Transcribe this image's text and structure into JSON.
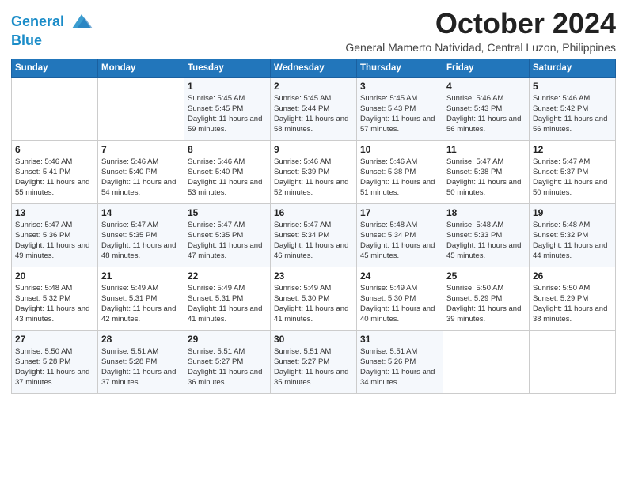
{
  "header": {
    "logo_line1": "General",
    "logo_line2": "Blue",
    "month_year": "October 2024",
    "location": "General Mamerto Natividad, Central Luzon, Philippines"
  },
  "days_of_week": [
    "Sunday",
    "Monday",
    "Tuesday",
    "Wednesday",
    "Thursday",
    "Friday",
    "Saturday"
  ],
  "weeks": [
    [
      {
        "day": "",
        "info": ""
      },
      {
        "day": "",
        "info": ""
      },
      {
        "day": "1",
        "info": "Sunrise: 5:45 AM\nSunset: 5:45 PM\nDaylight: 11 hours and 59 minutes."
      },
      {
        "day": "2",
        "info": "Sunrise: 5:45 AM\nSunset: 5:44 PM\nDaylight: 11 hours and 58 minutes."
      },
      {
        "day": "3",
        "info": "Sunrise: 5:45 AM\nSunset: 5:43 PM\nDaylight: 11 hours and 57 minutes."
      },
      {
        "day": "4",
        "info": "Sunrise: 5:46 AM\nSunset: 5:43 PM\nDaylight: 11 hours and 56 minutes."
      },
      {
        "day": "5",
        "info": "Sunrise: 5:46 AM\nSunset: 5:42 PM\nDaylight: 11 hours and 56 minutes."
      }
    ],
    [
      {
        "day": "6",
        "info": "Sunrise: 5:46 AM\nSunset: 5:41 PM\nDaylight: 11 hours and 55 minutes."
      },
      {
        "day": "7",
        "info": "Sunrise: 5:46 AM\nSunset: 5:40 PM\nDaylight: 11 hours and 54 minutes."
      },
      {
        "day": "8",
        "info": "Sunrise: 5:46 AM\nSunset: 5:40 PM\nDaylight: 11 hours and 53 minutes."
      },
      {
        "day": "9",
        "info": "Sunrise: 5:46 AM\nSunset: 5:39 PM\nDaylight: 11 hours and 52 minutes."
      },
      {
        "day": "10",
        "info": "Sunrise: 5:46 AM\nSunset: 5:38 PM\nDaylight: 11 hours and 51 minutes."
      },
      {
        "day": "11",
        "info": "Sunrise: 5:47 AM\nSunset: 5:38 PM\nDaylight: 11 hours and 50 minutes."
      },
      {
        "day": "12",
        "info": "Sunrise: 5:47 AM\nSunset: 5:37 PM\nDaylight: 11 hours and 50 minutes."
      }
    ],
    [
      {
        "day": "13",
        "info": "Sunrise: 5:47 AM\nSunset: 5:36 PM\nDaylight: 11 hours and 49 minutes."
      },
      {
        "day": "14",
        "info": "Sunrise: 5:47 AM\nSunset: 5:35 PM\nDaylight: 11 hours and 48 minutes."
      },
      {
        "day": "15",
        "info": "Sunrise: 5:47 AM\nSunset: 5:35 PM\nDaylight: 11 hours and 47 minutes."
      },
      {
        "day": "16",
        "info": "Sunrise: 5:47 AM\nSunset: 5:34 PM\nDaylight: 11 hours and 46 minutes."
      },
      {
        "day": "17",
        "info": "Sunrise: 5:48 AM\nSunset: 5:34 PM\nDaylight: 11 hours and 45 minutes."
      },
      {
        "day": "18",
        "info": "Sunrise: 5:48 AM\nSunset: 5:33 PM\nDaylight: 11 hours and 45 minutes."
      },
      {
        "day": "19",
        "info": "Sunrise: 5:48 AM\nSunset: 5:32 PM\nDaylight: 11 hours and 44 minutes."
      }
    ],
    [
      {
        "day": "20",
        "info": "Sunrise: 5:48 AM\nSunset: 5:32 PM\nDaylight: 11 hours and 43 minutes."
      },
      {
        "day": "21",
        "info": "Sunrise: 5:49 AM\nSunset: 5:31 PM\nDaylight: 11 hours and 42 minutes."
      },
      {
        "day": "22",
        "info": "Sunrise: 5:49 AM\nSunset: 5:31 PM\nDaylight: 11 hours and 41 minutes."
      },
      {
        "day": "23",
        "info": "Sunrise: 5:49 AM\nSunset: 5:30 PM\nDaylight: 11 hours and 41 minutes."
      },
      {
        "day": "24",
        "info": "Sunrise: 5:49 AM\nSunset: 5:30 PM\nDaylight: 11 hours and 40 minutes."
      },
      {
        "day": "25",
        "info": "Sunrise: 5:50 AM\nSunset: 5:29 PM\nDaylight: 11 hours and 39 minutes."
      },
      {
        "day": "26",
        "info": "Sunrise: 5:50 AM\nSunset: 5:29 PM\nDaylight: 11 hours and 38 minutes."
      }
    ],
    [
      {
        "day": "27",
        "info": "Sunrise: 5:50 AM\nSunset: 5:28 PM\nDaylight: 11 hours and 37 minutes."
      },
      {
        "day": "28",
        "info": "Sunrise: 5:51 AM\nSunset: 5:28 PM\nDaylight: 11 hours and 37 minutes."
      },
      {
        "day": "29",
        "info": "Sunrise: 5:51 AM\nSunset: 5:27 PM\nDaylight: 11 hours and 36 minutes."
      },
      {
        "day": "30",
        "info": "Sunrise: 5:51 AM\nSunset: 5:27 PM\nDaylight: 11 hours and 35 minutes."
      },
      {
        "day": "31",
        "info": "Sunrise: 5:51 AM\nSunset: 5:26 PM\nDaylight: 11 hours and 34 minutes."
      },
      {
        "day": "",
        "info": ""
      },
      {
        "day": "",
        "info": ""
      }
    ]
  ]
}
